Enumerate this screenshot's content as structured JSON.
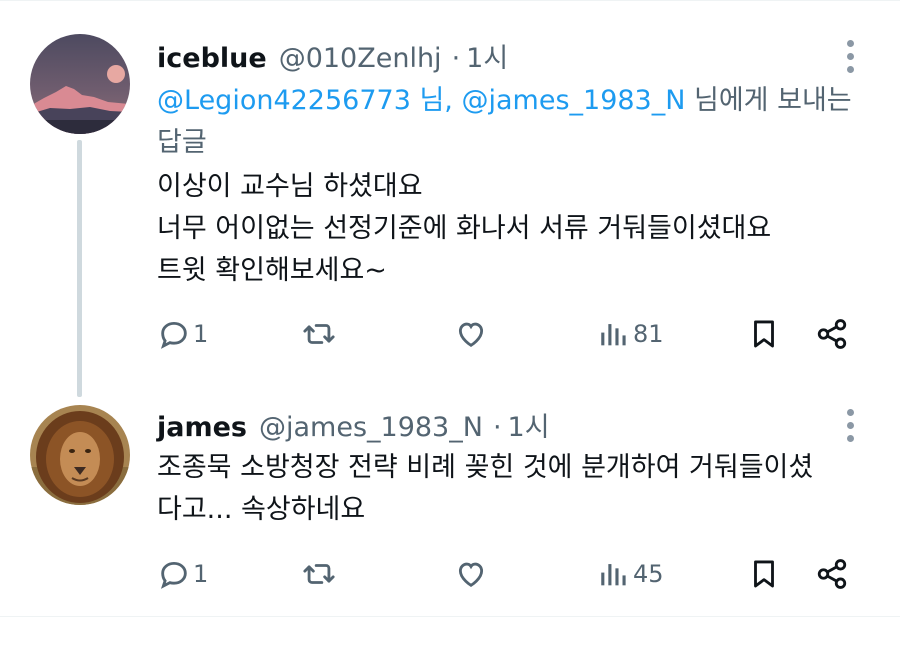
{
  "tweets": [
    {
      "name": "iceblue",
      "handle": "@010Zenlhj",
      "dot": "·",
      "time": "1시",
      "replying_mention_1": "@Legion42256773 님,",
      "replying_mention_2": "@james_1983_N",
      "replying_suffix": " 님에게 보내는",
      "replying_line2": "답글",
      "lines": [
        "이상이 교수님 하셨대요",
        "너무 어이없는 선정기준에 화나서 서류 거둬들이셨대요",
        "트윗 확인해보세요~"
      ],
      "replies": "1",
      "views": "81",
      "avatar_icon": "mountain-sunset-avatar"
    },
    {
      "name": "james",
      "handle": "@james_1983_N",
      "dot": "·",
      "time": "1시",
      "lines": [
        "조종묵 소방청장 전략 비례 꽂힌 것에 분개하여 거둬들이셨",
        "다고... 속상하네요"
      ],
      "replies": "1",
      "views": "45",
      "avatar_icon": "lion-avatar"
    }
  ],
  "colors": {
    "text": "#0f1419",
    "secondary": "#536471",
    "mention": "#1d9bf0",
    "thread_line": "#cfd9de",
    "divider": "#eff3f4"
  }
}
